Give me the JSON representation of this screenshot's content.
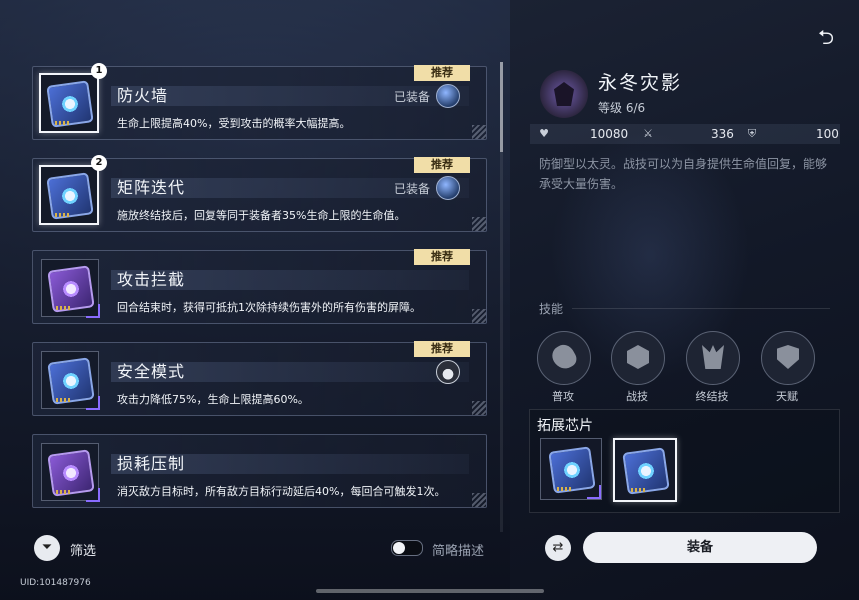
{
  "chips": [
    {
      "name": "防火墙",
      "desc": "生命上限提高40%，受到攻击的概率大幅提高。",
      "tag": "推荐",
      "equipped": "已装备",
      "badge": "1",
      "variant": "blue"
    },
    {
      "name": "矩阵迭代",
      "desc": "施放终结技后，回复等同于装备者35%生命上限的生命值。",
      "tag": "推荐",
      "equipped": "已装备",
      "badge": "2",
      "variant": "blue"
    },
    {
      "name": "攻击拦截",
      "desc": "回合结束时，获得可抵抗1次除持续伤害外的所有伤害的屏障。",
      "tag": "推荐",
      "variant": "purple"
    },
    {
      "name": "安全模式",
      "desc": "攻击力降低75%，生命上限提高60%。",
      "tag": "推荐",
      "variant": "blue"
    },
    {
      "name": "损耗压制",
      "desc": "消灭敌方目标时，所有敌方目标行动延后40%，每回合可触发1次。",
      "variant": "purple"
    }
  ],
  "footer": {
    "filter_label": "筛选",
    "toggle_label": "简略描述",
    "uid": "UID:101487976"
  },
  "detail": {
    "name": "永冬灾影",
    "level_label": "等级",
    "level_value": "6/6",
    "stats": {
      "hp": "10080",
      "atk": "336",
      "def": "100"
    },
    "description": "防御型以太灵。战技可以为自身提供生命值回复，能够承受大量伤害。",
    "skills_title": "技能",
    "skills": [
      "普攻",
      "战技",
      "终结技",
      "天赋"
    ],
    "ext_title": "拓展芯片",
    "equip_label": "装备"
  },
  "icons": {
    "back": "back-arrow-icon",
    "filter": "funnel-icon",
    "swap": "swap-icon",
    "hp": "heart-icon",
    "atk": "sword-icon",
    "def": "shield-icon"
  },
  "colors": {
    "tag_bg": "#f1dea8",
    "accent_purple": "#8a6cff",
    "chip_blue": "#4c6fd6",
    "chip_purple": "#8a5ad6"
  }
}
